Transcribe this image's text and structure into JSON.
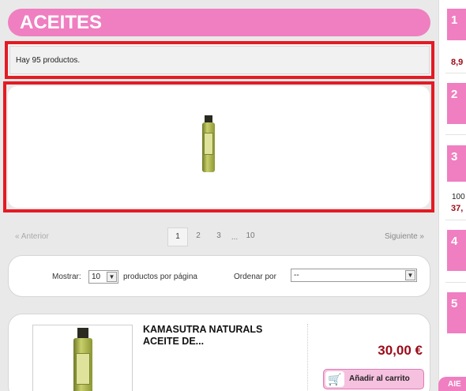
{
  "category": {
    "title": "ACEITES"
  },
  "listing": {
    "count_text": "Hay 95 productos."
  },
  "pagination": {
    "prev_label": "« Anterior",
    "next_label": "Siguiente »",
    "pages": [
      "1",
      "2",
      "3",
      "10"
    ],
    "ellipsis": "...",
    "active_page": "1"
  },
  "options": {
    "show_label": "Mostrar:",
    "show_value": "10",
    "per_page_label": "productos por página",
    "sort_label": "Ordenar por",
    "sort_value": "--"
  },
  "product": {
    "name": "KAMASUTRA NATURALS ACEITE DE...",
    "price": "30,00 €",
    "add_to_cart": "Añadir al carrito"
  },
  "sidebar": {
    "ranks": [
      {
        "number": "1",
        "price": "8,9"
      },
      {
        "number": "2"
      },
      {
        "number": "3",
        "text": "100",
        "price": "37,"
      },
      {
        "number": "4"
      },
      {
        "number": "5"
      }
    ],
    "tab_label": "AIE"
  },
  "colors": {
    "accent_pink": "#ef7fc1",
    "highlight_red": "#e31b23",
    "price_red": "#9a0b18"
  },
  "icons": {
    "cart": "shopping-cart-icon",
    "select_arrow": "chevron-down-icon"
  }
}
